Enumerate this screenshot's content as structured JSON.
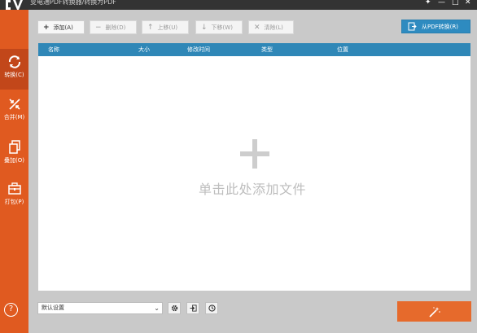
{
  "window": {
    "title": "变电通PDF转换器/转换为PDF",
    "minimize_glyph": "—",
    "maximize_glyph": "□",
    "close_glyph": "✕",
    "pin_glyph": "✦"
  },
  "sidebar": {
    "items": [
      {
        "label": "转换(C)",
        "icon": "convert-icon",
        "active": true
      },
      {
        "label": "合并(M)",
        "icon": "merge-icon",
        "active": false
      },
      {
        "label": "叠加(O)",
        "icon": "overlay-icon",
        "active": false
      },
      {
        "label": "打包(P)",
        "icon": "package-icon",
        "active": false
      }
    ],
    "help_glyph": "?"
  },
  "toolbar": {
    "add": {
      "label": "添加(A)",
      "icon": "+"
    },
    "delete": {
      "label": "删除(D)",
      "icon": "−"
    },
    "move_up": {
      "label": "上移(U)",
      "icon": "↑"
    },
    "move_down": {
      "label": "下移(W)",
      "icon": "↓"
    },
    "clear": {
      "label": "清除(L)",
      "icon": "✕"
    },
    "from_pdf": {
      "label": "从PDF转换(R)"
    }
  },
  "file_list": {
    "columns": [
      "名称",
      "大小",
      "修改时间",
      "类型",
      "位置"
    ],
    "rows": [],
    "empty_hint": "单击此处添加文件"
  },
  "bottom": {
    "preset": {
      "value": "默认设置",
      "arrow": "⌄"
    }
  },
  "colors": {
    "accent_orange": "#e05a20",
    "header_blue": "#2f87b7",
    "title_bar": "#333333"
  }
}
